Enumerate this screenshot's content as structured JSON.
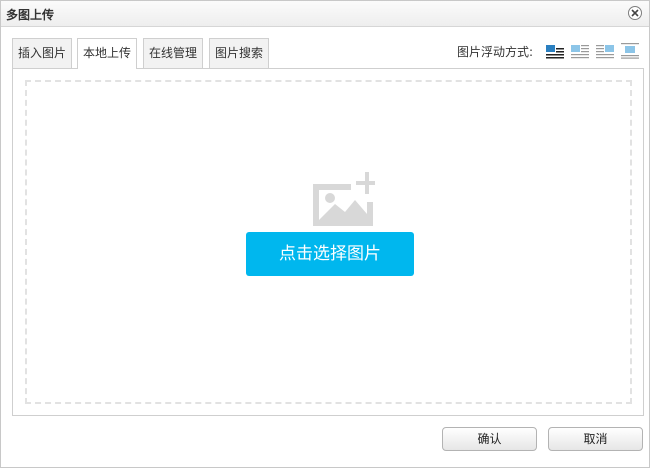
{
  "dialog": {
    "title": "多图上传"
  },
  "tabs": [
    {
      "label": "插入图片",
      "active": false
    },
    {
      "label": "本地上传",
      "active": true
    },
    {
      "label": "在线管理",
      "active": false
    },
    {
      "label": "图片搜索",
      "active": false
    }
  ],
  "alignment": {
    "label": "图片浮动方式:",
    "options": [
      "none",
      "left",
      "right",
      "center"
    ],
    "selected": "none"
  },
  "upload": {
    "pick_label": "点击选择图片"
  },
  "footer": {
    "ok_label": "确认",
    "cancel_label": "取消"
  },
  "colors": {
    "accent": "#00b7ee",
    "icon_gray": "#d8d8d8",
    "align_blue": "#8cc5e8"
  }
}
